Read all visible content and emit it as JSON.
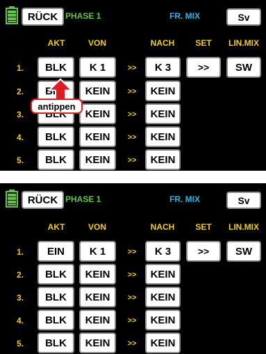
{
  "screen1": {
    "header": {
      "back": "RÜCK",
      "phase": "PHASE 1",
      "title": "FR. MIX",
      "save": "Sv"
    },
    "columns": {
      "akt": "AKT",
      "von": "VON",
      "nach": "NACH",
      "set": "SET",
      "linmix": "LIN.MIX"
    },
    "rows": [
      {
        "num": "1.",
        "akt": "BLK",
        "von": "K 1",
        "arrows": ">>",
        "nach": "K 3",
        "set": ">>",
        "linmix": "SW"
      },
      {
        "num": "2.",
        "akt": "BLK",
        "von": "KEIN",
        "arrows": ">>",
        "nach": "KEIN"
      },
      {
        "num": "3.",
        "akt": "BLK",
        "von": "KEIN",
        "arrows": ">>",
        "nach": "KEIN"
      },
      {
        "num": "4.",
        "akt": "BLK",
        "von": "KEIN",
        "arrows": ">>",
        "nach": "KEIN"
      },
      {
        "num": "5.",
        "akt": "BLK",
        "von": "KEIN",
        "arrows": ">>",
        "nach": "KEIN"
      }
    ],
    "callout": "antippen"
  },
  "screen2": {
    "header": {
      "back": "RÜCK",
      "phase": "PHASE 1",
      "title": "FR. MIX",
      "save": "Sv"
    },
    "columns": {
      "akt": "AKT",
      "von": "VON",
      "nach": "NACH",
      "set": "SET",
      "linmix": "LIN.MIX"
    },
    "rows": [
      {
        "num": "1.",
        "akt": "EIN",
        "von": "K 1",
        "arrows": ">>",
        "nach": "K 3",
        "set": ">>",
        "linmix": "SW"
      },
      {
        "num": "2.",
        "akt": "BLK",
        "von": "KEIN",
        "arrows": ">>",
        "nach": "KEIN"
      },
      {
        "num": "3.",
        "akt": "BLK",
        "von": "KEIN",
        "arrows": ">>",
        "nach": "KEIN"
      },
      {
        "num": "4.",
        "akt": "BLK",
        "von": "KEIN",
        "arrows": ">>",
        "nach": "KEIN"
      },
      {
        "num": "5.",
        "akt": "BLK",
        "von": "KEIN",
        "arrows": ">>",
        "nach": "KEIN"
      }
    ]
  },
  "colors": {
    "yellow": "#f4d000",
    "green": "#5ec83c",
    "cyan": "#21b7e8",
    "callout_red": "#e11b22"
  },
  "icons": {
    "battery": "battery-icon",
    "pointer": "up-arrow-icon"
  }
}
